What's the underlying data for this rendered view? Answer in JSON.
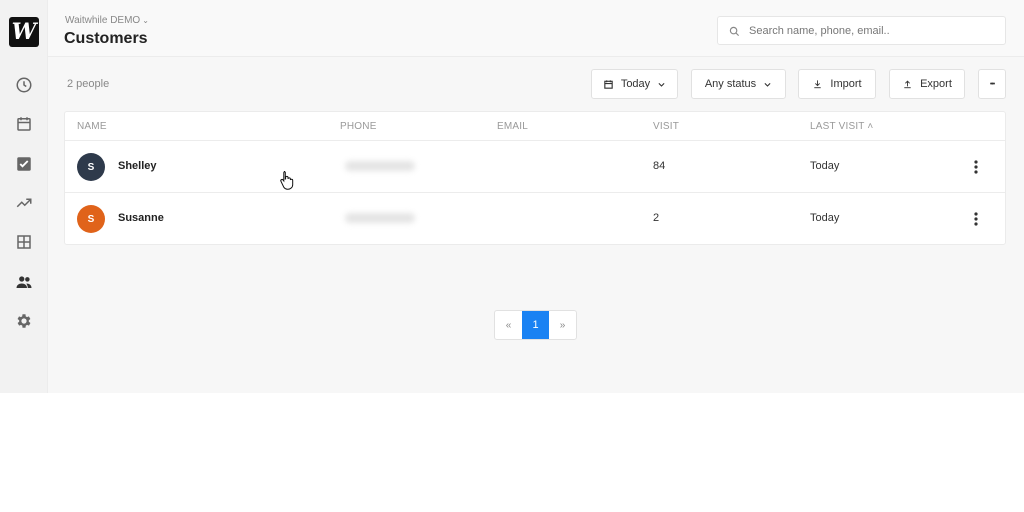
{
  "app": {
    "logo_letter": "W",
    "org_name": "Waitwhile DEMO",
    "page_title": "Customers"
  },
  "search": {
    "placeholder": "Search name, phone, email..",
    "value": ""
  },
  "sidebar": {
    "items": [
      {
        "icon": "clock-icon"
      },
      {
        "icon": "calendar-icon"
      },
      {
        "icon": "checkbox-icon"
      },
      {
        "icon": "trending-icon"
      },
      {
        "icon": "grid-icon"
      },
      {
        "icon": "people-icon",
        "active": true
      },
      {
        "icon": "gear-icon"
      }
    ]
  },
  "toolbar": {
    "count_label": "2 people",
    "date_filter": "Today",
    "status_filter": "Any status",
    "import_label": "Import",
    "export_label": "Export",
    "more_label": "•••"
  },
  "table": {
    "columns": [
      "NAME",
      "PHONE",
      "EMAIL",
      "VISIT",
      "LAST VISIT"
    ],
    "sort_indicator": "˄",
    "rows": [
      {
        "initial": "S",
        "avatar_color": "#2e3a4b",
        "name": "Shelley",
        "phone": "",
        "email": "",
        "visits": "84",
        "last_visit": "Today"
      },
      {
        "initial": "S",
        "avatar_color": "#e0631a",
        "name": "Susanne",
        "phone": "",
        "email": "",
        "visits": "2",
        "last_visit": "Today"
      }
    ]
  },
  "pagination": {
    "prev": "«",
    "current": "1",
    "next": "»"
  },
  "colors": {
    "accent": "#1a82f3",
    "sidebar_bg": "#f2f2f2"
  }
}
